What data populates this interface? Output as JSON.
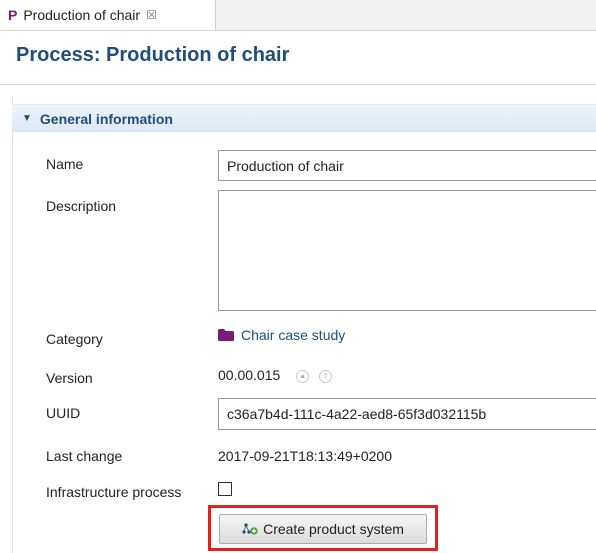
{
  "tab": {
    "icon_letter": "P",
    "title": "Production of chair",
    "close": "☒"
  },
  "header": {
    "title": "Process: Production of chair"
  },
  "section": {
    "title": "General information"
  },
  "labels": {
    "name": "Name",
    "description": "Description",
    "category": "Category",
    "version": "Version",
    "uuid": "UUID",
    "last_change": "Last change",
    "infrastructure": "Infrastructure process"
  },
  "values": {
    "name": "Production of chair",
    "description": "",
    "category": "Chair case study",
    "version": "00.00.015",
    "uuid": "c36a7b4d-111c-4a22-aed8-65f3d032115b",
    "last_change": "2017-09-21T18:13:49+0200",
    "infrastructure_checked": false
  },
  "buttons": {
    "create_product_system": "Create product system"
  },
  "icons": {
    "folder": "folder-icon",
    "product_system": "product-system-icon",
    "section_toggle": "chevron-down-icon"
  },
  "colors": {
    "title": "#1f4e79",
    "folder": "#7b1a7a",
    "highlight": "#e0231f"
  }
}
